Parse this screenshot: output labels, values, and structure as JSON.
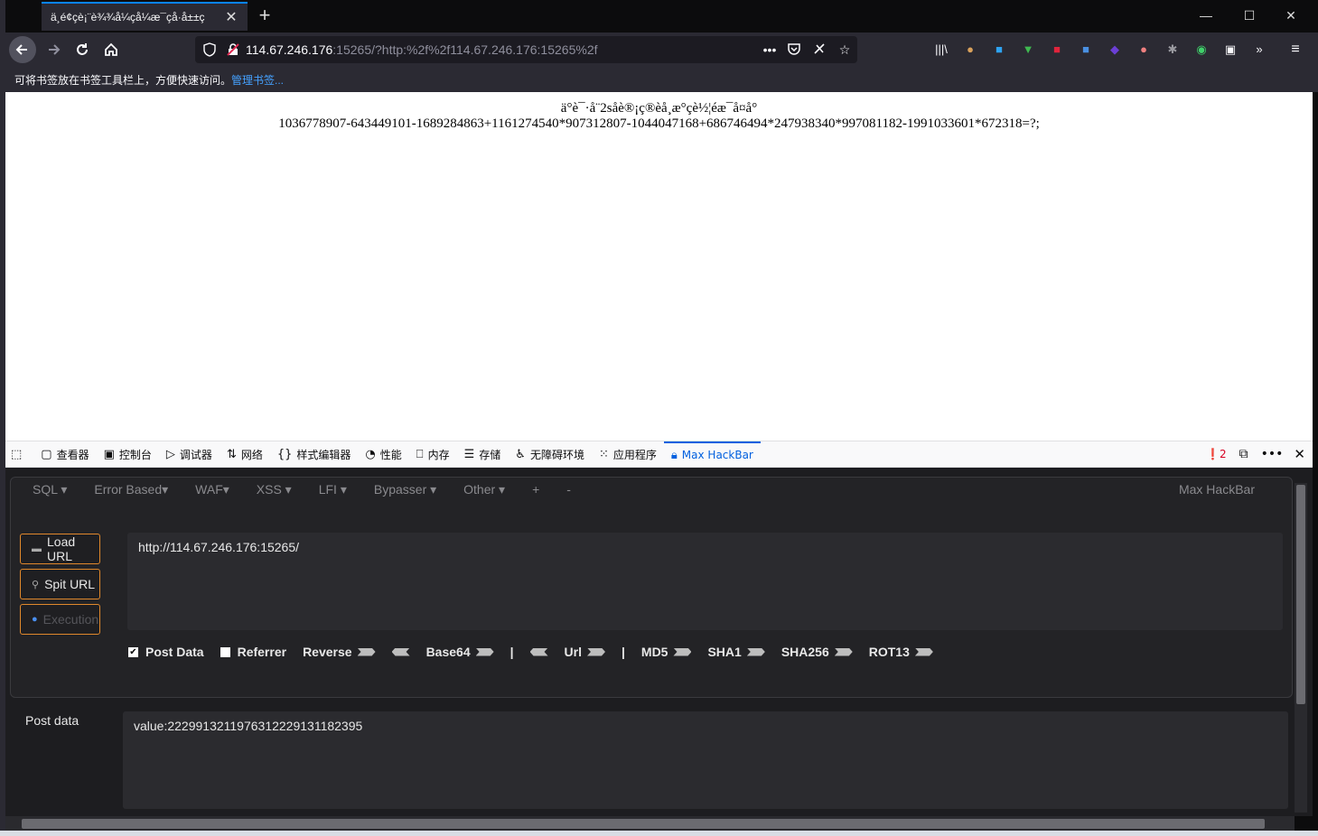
{
  "tab": {
    "title": "ä¸é¢çè¡¨è¾¾å¼çå¼æ¯çå·å±±ç"
  },
  "window_controls": {
    "minimize": "—",
    "maximize": "☐",
    "close": "✕"
  },
  "address": {
    "host": "114.67.246.176",
    "rest": ":15265/?http:%2f%2f114.67.246.176:15265%2f"
  },
  "bookmarks_bar": {
    "text": "可将书签放在书签工具栏上，方便快速访问。",
    "link": "管理书签..."
  },
  "page": {
    "line1": "ä°è¯·å¨2såè®¡ç®èå¸æ°çè½¦éæ¯å¤å°",
    "line2": "1036778907-643449101-1689284863+1161274540*907312807-1044047168+686746494*247938340*997081182-1991033601*672318=?;"
  },
  "devtools": {
    "tabs": [
      {
        "label": "查看器",
        "icon": "inspector-icon"
      },
      {
        "label": "控制台",
        "icon": "console-icon"
      },
      {
        "label": "调试器",
        "icon": "debugger-icon"
      },
      {
        "label": "网络",
        "icon": "network-icon"
      },
      {
        "label": "样式编辑器",
        "icon": "style-editor-icon"
      },
      {
        "label": "性能",
        "icon": "performance-icon"
      },
      {
        "label": "内存",
        "icon": "memory-icon"
      },
      {
        "label": "存储",
        "icon": "storage-icon"
      },
      {
        "label": "无障碍环境",
        "icon": "accessibility-icon"
      },
      {
        "label": "应用程序",
        "icon": "application-icon"
      },
      {
        "label": "Max HackBar",
        "icon": "hackbar-icon"
      }
    ],
    "error_count": "2"
  },
  "hackbar": {
    "menu": [
      "SQL ▾",
      "Error Based▾",
      "WAF▾",
      "XSS ▾",
      "LFI ▾",
      "Bypasser ▾",
      "Other ▾",
      "+",
      "-"
    ],
    "brand": "Max HackBar",
    "load_url": "Load URL",
    "split_url": "Spit URL",
    "execution": "Execution",
    "url_value": "http://114.67.246.176:15265/",
    "options": {
      "post_data": "Post Data",
      "referrer": "Referrer",
      "reverse": "Reverse",
      "base64": "Base64",
      "sep": "|",
      "url": "Url",
      "md5": "MD5",
      "sha1": "SHA1",
      "sha256": "SHA256",
      "rot13": "ROT13"
    },
    "post_label": "Post data",
    "post_value": "value:2229913211976312229131182395"
  }
}
